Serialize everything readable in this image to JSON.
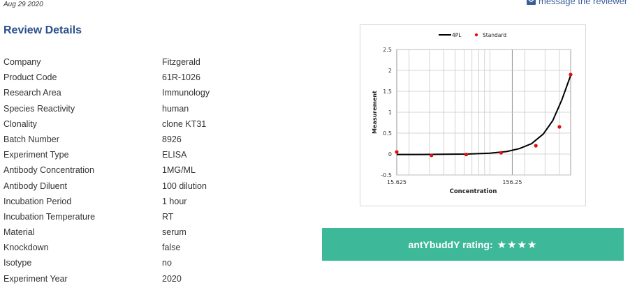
{
  "date": "Aug 29 2020",
  "message_link": {
    "label": "message the reviewer",
    "icon": "envelope-icon"
  },
  "heading": "Review Details",
  "details": [
    {
      "label": "Company",
      "value": "Fitzgerald"
    },
    {
      "label": "Product Code",
      "value": "61R-1026"
    },
    {
      "label": "Research Area",
      "value": "Immunology"
    },
    {
      "label": "Species Reactivity",
      "value": "human"
    },
    {
      "label": "Clonality",
      "value": "clone KT31"
    },
    {
      "label": "Batch Number",
      "value": "8926"
    },
    {
      "label": "Experiment Type",
      "value": "ELISA"
    },
    {
      "label": "Antibody Concentration",
      "value": "1MG/ML"
    },
    {
      "label": "Antibody Diluent",
      "value": "100 dilution"
    },
    {
      "label": "Incubation Period",
      "value": "1 hour"
    },
    {
      "label": "Incubation Temperature",
      "value": "RT"
    },
    {
      "label": "Material",
      "value": "serum"
    },
    {
      "label": "Knockdown",
      "value": "false"
    },
    {
      "label": "Isotype",
      "value": "no"
    },
    {
      "label": "Experiment Year",
      "value": "2020"
    }
  ],
  "rating": {
    "label": "antYbuddY rating:",
    "stars": 4,
    "star_glyph": "★",
    "color": "#3db898"
  },
  "chart_data": {
    "type": "scatter",
    "x_scale": "log",
    "xlabel": "Concentration",
    "ylabel": "Measurement",
    "x_ticks": [
      15.625,
      156.25
    ],
    "x_tick_labels": [
      "15.625",
      "156.25"
    ],
    "xlim": [
      15.625,
      500
    ],
    "ylim": [
      -0.5,
      2.5
    ],
    "y_ticks": [
      -0.5,
      0,
      0.5,
      1,
      1.5,
      2,
      2.5
    ],
    "y_tick_labels": [
      "-0.5",
      "0",
      "0.5",
      "1",
      "1.5",
      "2",
      "2.5"
    ],
    "grid": true,
    "legend_position": "top",
    "series": [
      {
        "name": "4PL",
        "kind": "line",
        "color": "#000000",
        "x": [
          15.625,
          25,
          40,
          63,
          100,
          140,
          180,
          230,
          290,
          350,
          420,
          500
        ],
        "y": [
          -0.01,
          -0.01,
          -0.005,
          0.0,
          0.02,
          0.06,
          0.13,
          0.25,
          0.48,
          0.8,
          1.3,
          1.88
        ]
      },
      {
        "name": "Standard",
        "kind": "points",
        "color": "#e01010",
        "x": [
          15.625,
          31.25,
          62.5,
          125,
          250,
          400,
          500
        ],
        "y": [
          0.05,
          -0.03,
          -0.01,
          0.03,
          0.2,
          0.65,
          1.9
        ]
      }
    ]
  }
}
